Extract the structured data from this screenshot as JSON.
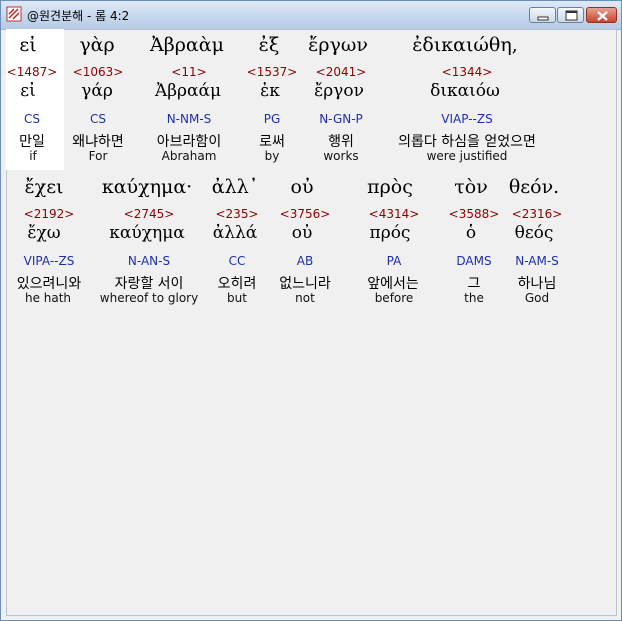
{
  "window": {
    "title": "@원견분해 - 롬 4:2",
    "controls": [
      "minimize",
      "maximize",
      "close"
    ]
  },
  "colors": {
    "strong_number": "#8b0000",
    "morphology": "#1c2fb0",
    "highlight": "#ffffff"
  },
  "rows": [
    {
      "words": [
        {
          "greek": "εἰ",
          "strong": "<1487>",
          "lemma": "εἰ",
          "morph": "CS",
          "korean": "만일",
          "english": "if"
        },
        {
          "greek": "γὰρ",
          "strong": "<1063>",
          "lemma": "γάρ",
          "morph": "CS",
          "korean": "왜냐하면",
          "english": "For"
        },
        {
          "greek": "Ἀβραὰμ",
          "strong": "<11>",
          "lemma": "Ἀβραάμ",
          "morph": "N-NM-S",
          "korean": "아브라함이",
          "english": "Abraham"
        },
        {
          "greek": "ἐξ",
          "strong": "<1537>",
          "lemma": "ἐκ",
          "morph": "PG",
          "korean": "로써",
          "english": "by"
        },
        {
          "greek": "ἔργων",
          "strong": "<2041>",
          "lemma": "ἔργον",
          "morph": "N-GN-P",
          "korean": "행위",
          "english": "works"
        },
        {
          "greek": "ἐδικαιώθη,",
          "strong": "<1344>",
          "lemma": "δικαιόω",
          "morph": "VIAP--ZS",
          "korean": "의롭다 하심을 얻었으면",
          "english": "were justified"
        }
      ]
    },
    {
      "words": [
        {
          "greek": "ἔχει",
          "strong": "<2192>",
          "lemma": "ἔχω",
          "morph": "VIPA--ZS",
          "korean": "있으려니와",
          "english": "he hath"
        },
        {
          "greek": "καύχημα·",
          "strong": "<2745>",
          "lemma": "καύχημα",
          "morph": "N-AN-S",
          "korean": "자랑할 서이",
          "english": "whereof to glory"
        },
        {
          "greek": "ἀλλ᾽",
          "strong": "<235>",
          "lemma": "ἀλλά",
          "morph": "CC",
          "korean": "오히려",
          "english": "but"
        },
        {
          "greek": "οὐ",
          "strong": "<3756>",
          "lemma": "οὐ",
          "morph": "AB",
          "korean": "없느니라",
          "english": "not"
        },
        {
          "greek": "πρὸς",
          "strong": "<4314>",
          "lemma": "πρός",
          "morph": "PA",
          "korean": "앞에서는",
          "english": "before"
        },
        {
          "greek": "τὸν",
          "strong": "<3588>",
          "lemma": "ὁ",
          "morph": "DAMS",
          "korean": "그",
          "english": "the"
        },
        {
          "greek": "θεόν.",
          "strong": "<2316>",
          "lemma": "θεός",
          "morph": "N-AM-S",
          "korean": "하나님",
          "english": "God"
        }
      ]
    }
  ]
}
